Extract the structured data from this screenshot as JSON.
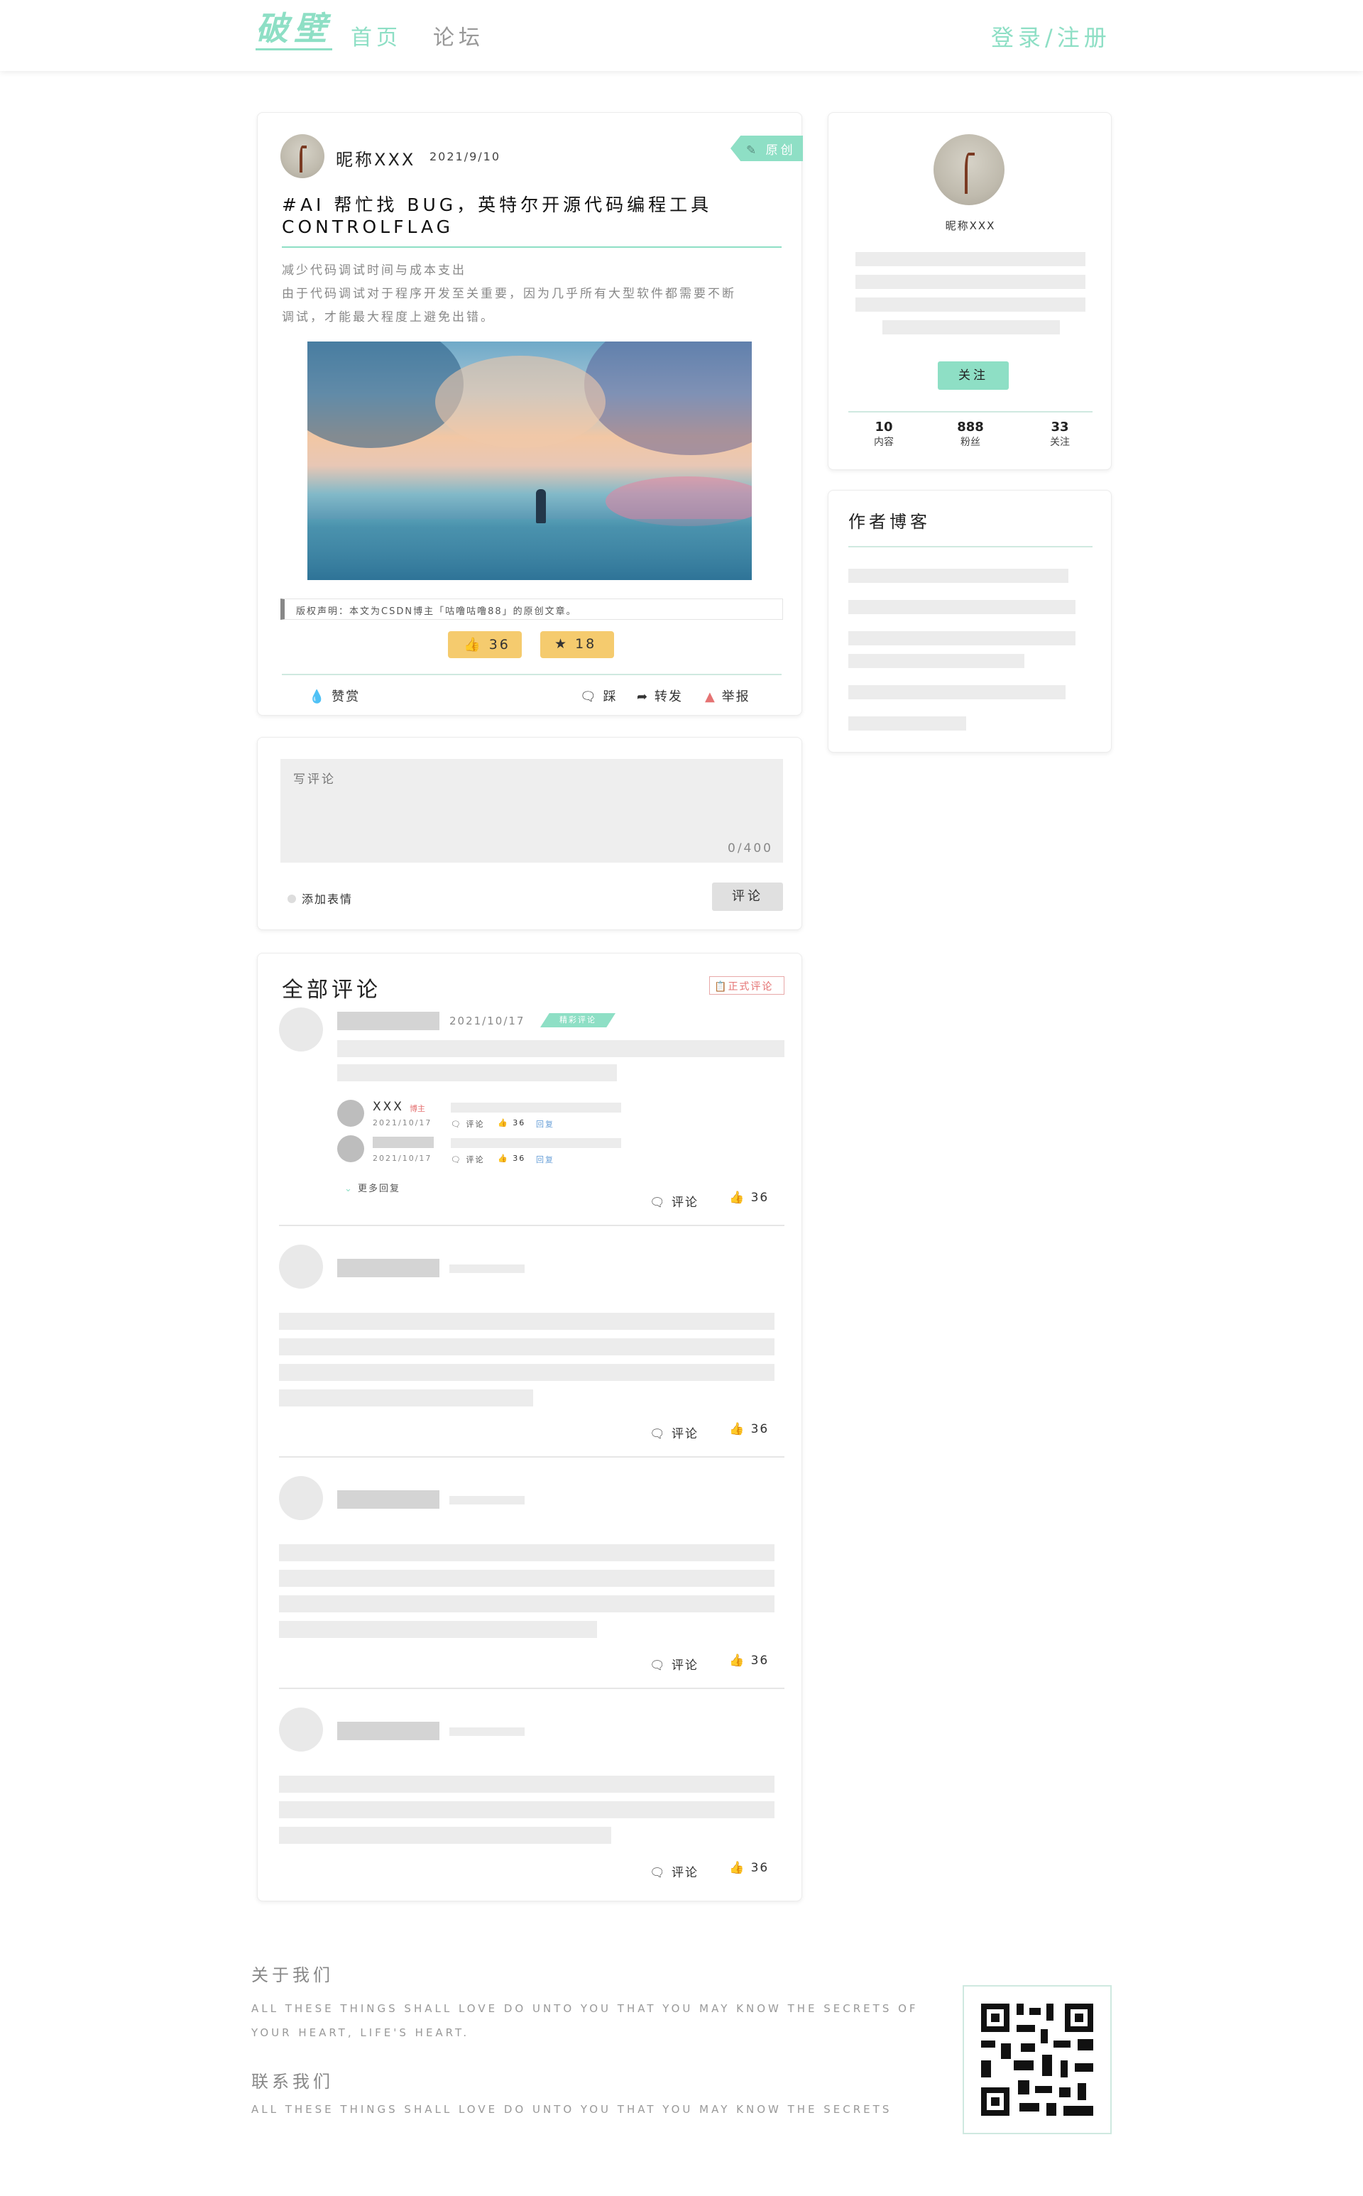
{
  "header": {
    "logo": "破壁",
    "nav_home": "首页",
    "nav_forum": "论坛",
    "login": "登录/注册"
  },
  "post": {
    "author": "昵称XXX",
    "date": "2021/9/10",
    "badge": "原创",
    "title_line1": "#AI 帮忙找 BUG，英特尔开源代码编程工具",
    "title_line2": "CONTROLFLAG",
    "summary1": "减少代码调试时间与成本支出",
    "summary2": "由于代码调试对于程序开发至关重要，因为几乎所有大型软件都需要不断",
    "summary3": "调试，才能最大程度上避免出错。",
    "copyright": "版权声明：本文为CSDN博主「咕噜咕噜88」的原创文章。",
    "likes": "36",
    "stars": "18",
    "reward": "赞赏",
    "dislike": "踩",
    "share": "转发",
    "report": "举报"
  },
  "comment_box": {
    "placeholder": "写评论",
    "counter": "0/400",
    "emoji": "添加表情",
    "submit": "评论"
  },
  "comments": {
    "title": "全部评论",
    "badge": "正式评论",
    "first_date": "2021/10/17",
    "hot_tag": "精彩评论",
    "reply1_name": "XXX",
    "reply1_tag": "博主",
    "reply1_date": "2021/10/17",
    "reply2_date": "2021/10/17",
    "reply_comment": "评论",
    "reply_likes": "36",
    "reply_reply": "回复",
    "more": "更多回复",
    "comment_label": "评论",
    "like_count": "36"
  },
  "profile": {
    "name": "昵称XXX",
    "follow": "关注",
    "stats": [
      {
        "value": "10",
        "label": "内容"
      },
      {
        "value": "888",
        "label": "粉丝"
      },
      {
        "value": "33",
        "label": "关注"
      }
    ]
  },
  "blog": {
    "title": "作者博客"
  },
  "footer": {
    "about_title": "关于我们",
    "about_line1": "ALL THESE THINGS SHALL LOVE DO UNTO YOU THAT YOU MAY KNOW THE SECRETS OF",
    "about_line2": "YOUR HEART, LIFE'S HEART.",
    "contact_title": "联系我们",
    "contact_line": "ALL THESE THINGS SHALL LOVE DO UNTO YOU THAT YOU MAY KNOW THE SECRETS"
  },
  "colors": {
    "accent": "#8edfc5",
    "like": "#f5cb6e"
  }
}
